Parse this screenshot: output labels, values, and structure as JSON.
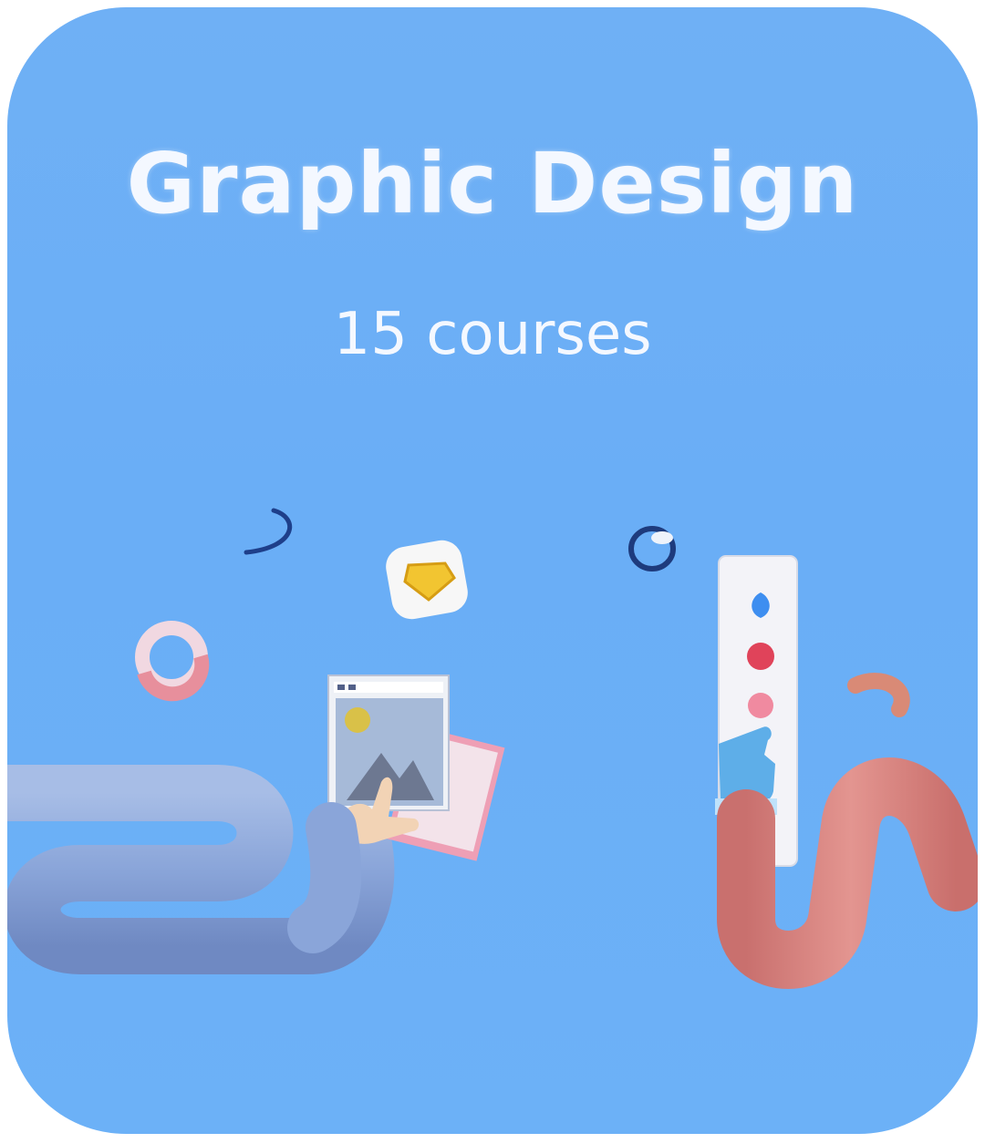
{
  "card": {
    "title": "Graphic Design",
    "subtitle": "15 courses",
    "background_color": "#6aaef6"
  },
  "illustration": {
    "description_icons": [
      "gem-badge-icon",
      "image-frame-icon",
      "pointing-hand-icon",
      "color-palette-panel-icon",
      "ring-shape-icon",
      "tube-arm-icon"
    ],
    "colors": {
      "blue_arm": "#8aa6d8",
      "pink_arm": "#d98a86",
      "gem": "#f2c531",
      "palette_blue": "#3e8ef0",
      "palette_red": "#e0435a",
      "palette_pink": "#f08aa0"
    }
  }
}
